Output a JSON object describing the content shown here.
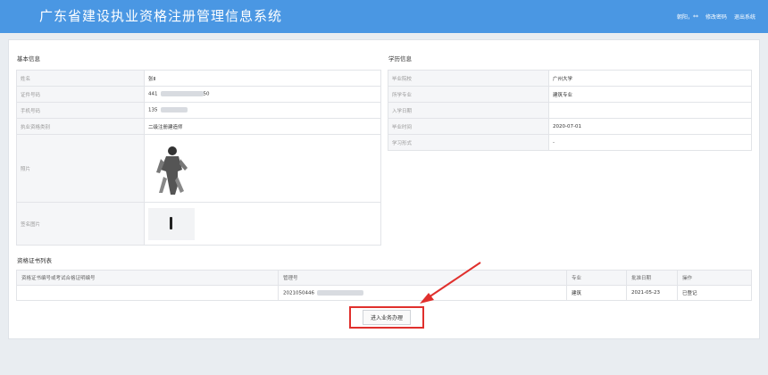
{
  "header": {
    "title": "广东省建设执业资格注册管理信息系统",
    "user": "朝阳，**",
    "edit_password": "修改密码",
    "logout": "退出系统"
  },
  "basic_info": {
    "title": "基本信息",
    "name_label": "姓名",
    "name_value": "张Ⅱ",
    "id_label": "证件号码",
    "id_prefix": "441",
    "id_suffix": "50",
    "phone_label": "手机号码",
    "phone_prefix": "135",
    "category_label": "执业资格类别",
    "category_value": "二级注册建造师",
    "photo_label": "照片",
    "signature_label": "签名图片"
  },
  "education": {
    "title": "学历信息",
    "school_label": "毕业院校",
    "school_value": "广州大学",
    "major_label": "所学专业",
    "major_value": "建筑专业",
    "enroll_label": "入学日期",
    "enroll_value": "",
    "grad_label": "毕业时间",
    "grad_value": "2020-07-01",
    "form_label": "学习形式",
    "form_value": "-"
  },
  "cert_list": {
    "title": "资格证书列表",
    "columns": [
      "资格证书编号或考试合格证明编号",
      "管理号",
      "专业",
      "批准日期",
      "操作"
    ],
    "row": {
      "cert_no": "",
      "manage_no_prefix": "2021050446",
      "major": "建筑",
      "date": "2021-05-23",
      "action": "已登记"
    }
  },
  "enter_button": "进入业务办理",
  "colors": {
    "header_blue": "#4a97e3",
    "highlight_red": "#e0302d"
  }
}
